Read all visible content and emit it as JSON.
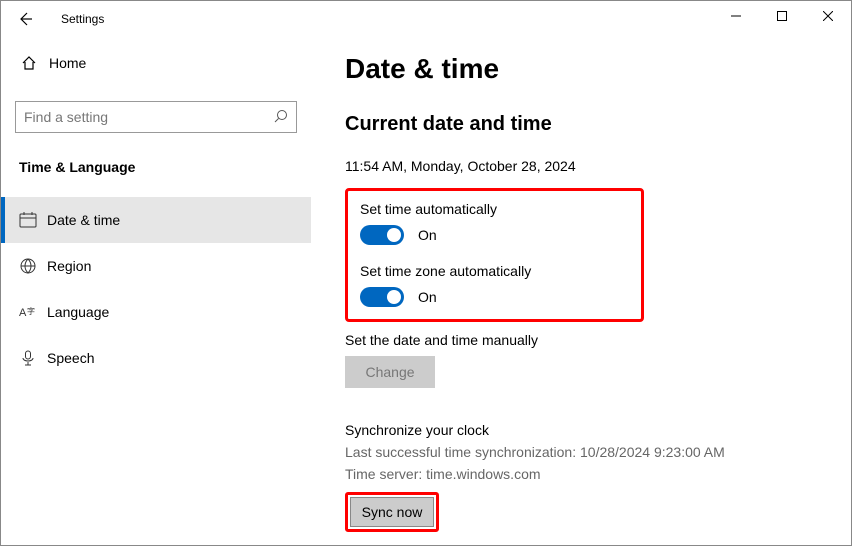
{
  "window": {
    "title": "Settings"
  },
  "sidebar": {
    "home": "Home",
    "search_placeholder": "Find a setting",
    "category": "Time & Language",
    "items": [
      {
        "label": "Date & time"
      },
      {
        "label": "Region"
      },
      {
        "label": "Language"
      },
      {
        "label": "Speech"
      }
    ]
  },
  "main": {
    "title": "Date & time",
    "current_heading": "Current date and time",
    "current_value": "11:54 AM, Monday, October 28, 2024",
    "set_time_auto": {
      "label": "Set time automatically",
      "state": "On"
    },
    "set_zone_auto": {
      "label": "Set time zone automatically",
      "state": "On"
    },
    "manual": {
      "label": "Set the date and time manually",
      "button": "Change"
    },
    "sync": {
      "heading": "Synchronize your clock",
      "last": "Last successful time synchronization: 10/28/2024 9:23:00 AM",
      "server": "Time server: time.windows.com",
      "button": "Sync now"
    }
  }
}
